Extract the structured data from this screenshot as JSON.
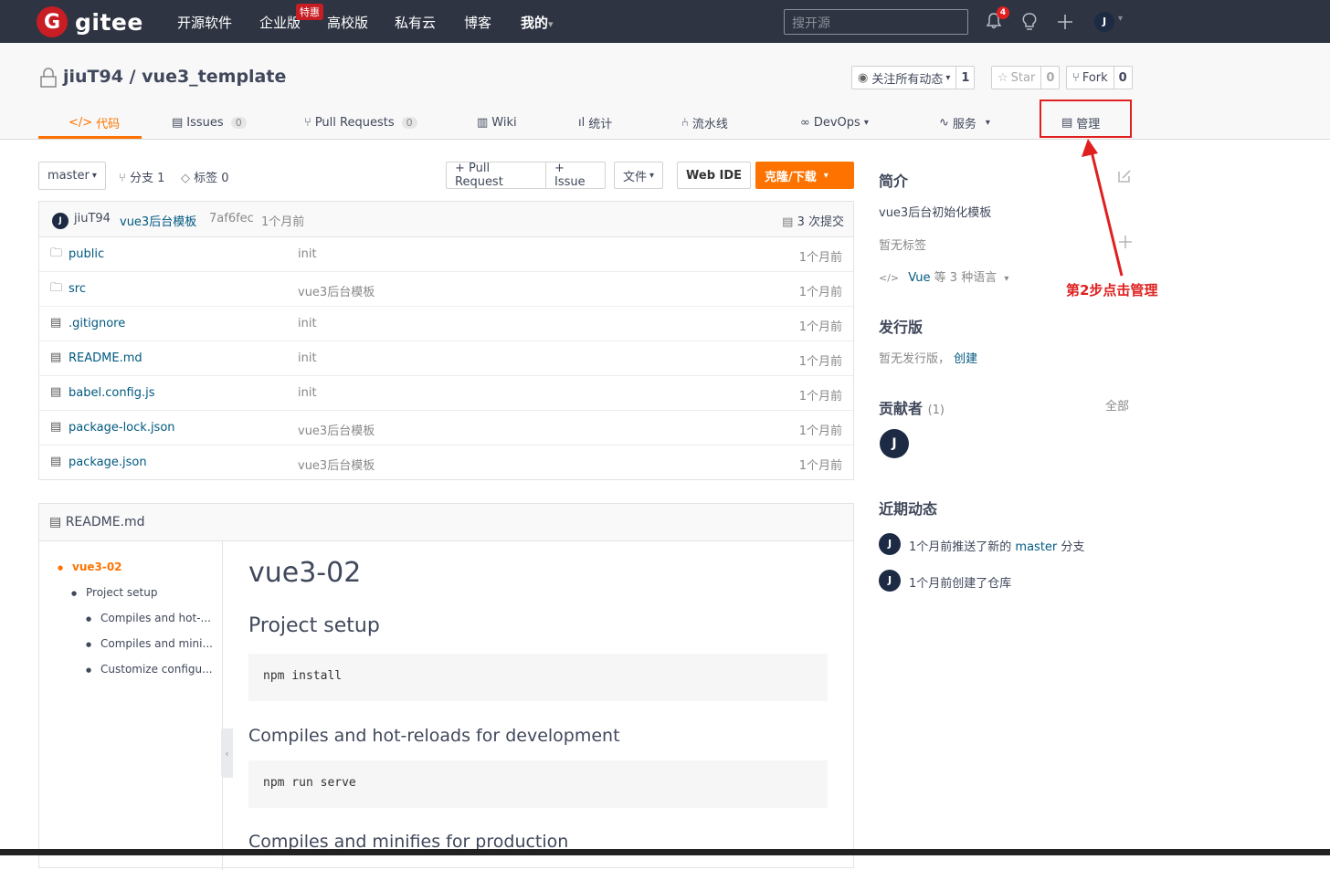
{
  "topnav": {
    "logo_mark": "G",
    "logo_text": "gitee",
    "items": [
      "开源软件",
      "企业版",
      "高校版",
      "私有云",
      "博客",
      "我的"
    ],
    "enterprise_badge": "特惠",
    "search_placeholder": "搜开源",
    "notification_count": "4",
    "avatar_initial": "J",
    "my_caret": "▾"
  },
  "repo": {
    "owner": "jiuT94",
    "separator": "/",
    "name": "vue3_template",
    "watch_label": "关注所有动态",
    "watch_count": "1",
    "star_label": "Star",
    "star_count": "0",
    "fork_label": "Fork",
    "fork_count": "0"
  },
  "tabs": [
    {
      "label": "代码",
      "icon": "code-icon"
    },
    {
      "label": "Issues",
      "count": "0",
      "icon": "issues-icon"
    },
    {
      "label": "Pull Requests",
      "count": "0",
      "icon": "pull-request-icon"
    },
    {
      "label": "Wiki",
      "icon": "wiki-icon"
    },
    {
      "label": "统计",
      "icon": "stats-icon"
    },
    {
      "label": "流水线",
      "icon": "pipeline-icon"
    },
    {
      "label": "DevOps",
      "icon": "devops-icon"
    },
    {
      "label": "服务",
      "icon": "service-icon"
    },
    {
      "label": "管理",
      "icon": "manage-icon"
    }
  ],
  "toolbar": {
    "branch": "master",
    "branches": "分支 1",
    "tags": "标签 0",
    "pull_request": "+ Pull Request",
    "issue": "+ Issue",
    "files": "文件",
    "web_ide": "Web IDE",
    "clone": "克隆/下载"
  },
  "commit": {
    "avatar_initial": "J",
    "author": "jiuT94",
    "message": "vue3后台模板",
    "hash": "7af6fec",
    "time": "1个月前",
    "commits": "3 次提交"
  },
  "files": [
    {
      "name": "public",
      "type": "folder",
      "message": "init",
      "time": "1个月前"
    },
    {
      "name": "src",
      "type": "folder",
      "message": "vue3后台模板",
      "time": "1个月前"
    },
    {
      "name": ".gitignore",
      "type": "file",
      "message": "init",
      "time": "1个月前"
    },
    {
      "name": "README.md",
      "type": "file",
      "message": "init",
      "time": "1个月前"
    },
    {
      "name": "babel.config.js",
      "type": "file",
      "message": "init",
      "time": "1个月前"
    },
    {
      "name": "package-lock.json",
      "type": "file",
      "message": "vue3后台模板",
      "time": "1个月前"
    },
    {
      "name": "package.json",
      "type": "file",
      "message": "vue3后台模板",
      "time": "1个月前"
    }
  ],
  "readme": {
    "filename": "README.md",
    "toc": [
      "vue3-02",
      "Project setup",
      "Compiles and hot-...",
      "Compiles and mini...",
      "Customize configu..."
    ],
    "h1": "vue3-02",
    "h2": "Project setup",
    "code1": "npm install",
    "h3_1": "Compiles and hot-reloads for development",
    "code2": "npm run serve",
    "h3_2": "Compiles and minifies for production"
  },
  "sidebar": {
    "intro_title": "简介",
    "intro_text": "vue3后台初始化模板",
    "no_tags": "暂无标签",
    "languages_link": "Vue",
    "languages_suffix": "等 3 种语言",
    "releases_title": "发行版",
    "no_release": "暂无发行版，",
    "create": "创建",
    "contributors_title": "贡献者",
    "contributors_count": "(1)",
    "all": "全部",
    "contributor_initial": "J",
    "activity_title": "近期动态",
    "activity": [
      {
        "initial": "J",
        "prefix": "1个月前推送了新的",
        "link": "master",
        "suffix": "分支"
      },
      {
        "initial": "J",
        "text": "1个月前创建了仓库"
      }
    ]
  },
  "annotation": "第2步点击管理",
  "colors": {
    "accent": "#fe7300",
    "nav_bg": "#2e3442",
    "annotation": "#e02020",
    "link": "#005980"
  }
}
